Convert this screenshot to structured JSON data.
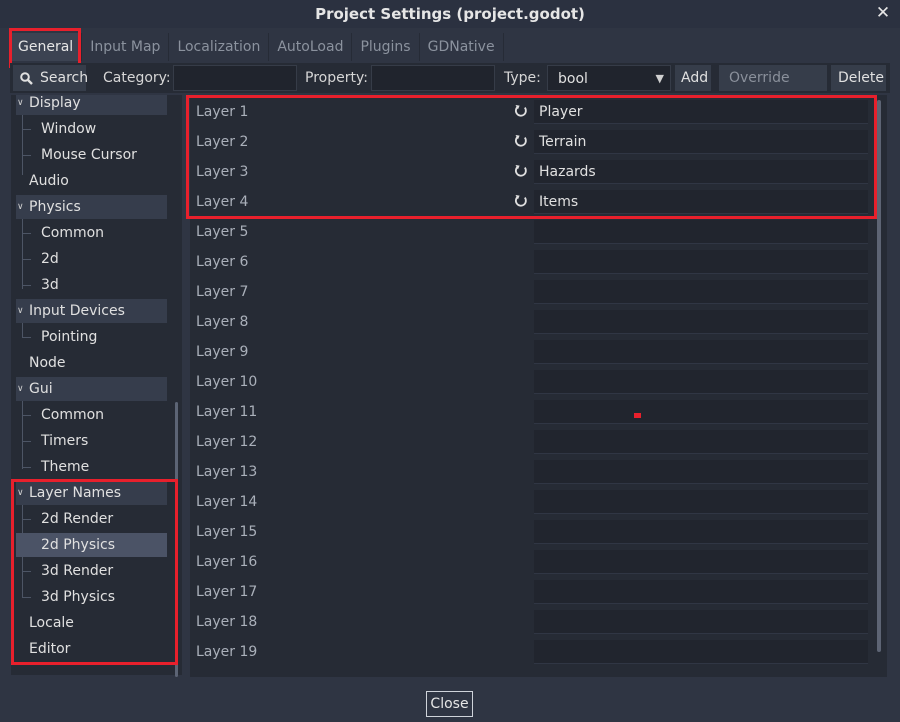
{
  "window": {
    "title": "Project Settings (project.godot)",
    "close_glyph": "✕"
  },
  "tabs": [
    {
      "label": "General",
      "active": true
    },
    {
      "label": "Input Map"
    },
    {
      "label": "Localization"
    },
    {
      "label": "AutoLoad"
    },
    {
      "label": "Plugins"
    },
    {
      "label": "GDNative"
    }
  ],
  "toolbar": {
    "search_label": "Search",
    "search_icon": "magnifier-icon",
    "category_label": "Category:",
    "category_value": "",
    "property_label": "Property:",
    "property_value": "",
    "type_label": "Type:",
    "type_value": "bool",
    "add_label": "Add",
    "override_label": "Override For...",
    "delete_label": "Delete"
  },
  "tree": {
    "display": "Display",
    "window": "Window",
    "mouse_cursor": "Mouse Cursor",
    "audio": "Audio",
    "physics": "Physics",
    "physics_common": "Common",
    "physics_2d": "2d",
    "physics_3d": "3d",
    "input_devices": "Input Devices",
    "pointing": "Pointing",
    "node": "Node",
    "gui": "Gui",
    "gui_common": "Common",
    "timers": "Timers",
    "theme": "Theme",
    "layer_names": "Layer Names",
    "render_2d": "2d Render",
    "physics_2d_layer": "2d Physics",
    "render_3d": "3d Render",
    "physics_3d_layer": "3d Physics",
    "locale": "Locale",
    "editor": "Editor"
  },
  "properties": [
    {
      "name": "Layer 1",
      "value": "Player"
    },
    {
      "name": "Layer 2",
      "value": "Terrain"
    },
    {
      "name": "Layer 3",
      "value": "Hazards"
    },
    {
      "name": "Layer 4",
      "value": "Items"
    },
    {
      "name": "Layer 5",
      "value": ""
    },
    {
      "name": "Layer 6",
      "value": ""
    },
    {
      "name": "Layer 7",
      "value": ""
    },
    {
      "name": "Layer 8",
      "value": ""
    },
    {
      "name": "Layer 9",
      "value": ""
    },
    {
      "name": "Layer 10",
      "value": ""
    },
    {
      "name": "Layer 11",
      "value": ""
    },
    {
      "name": "Layer 12",
      "value": ""
    },
    {
      "name": "Layer 13",
      "value": ""
    },
    {
      "name": "Layer 14",
      "value": ""
    },
    {
      "name": "Layer 15",
      "value": ""
    },
    {
      "name": "Layer 16",
      "value": ""
    },
    {
      "name": "Layer 17",
      "value": ""
    },
    {
      "name": "Layer 18",
      "value": ""
    },
    {
      "name": "Layer 19",
      "value": ""
    }
  ],
  "footer": {
    "close_label": "Close"
  },
  "colors": {
    "highlight": "#e8202c",
    "background": "#2f3543",
    "panel": "#262b35"
  }
}
